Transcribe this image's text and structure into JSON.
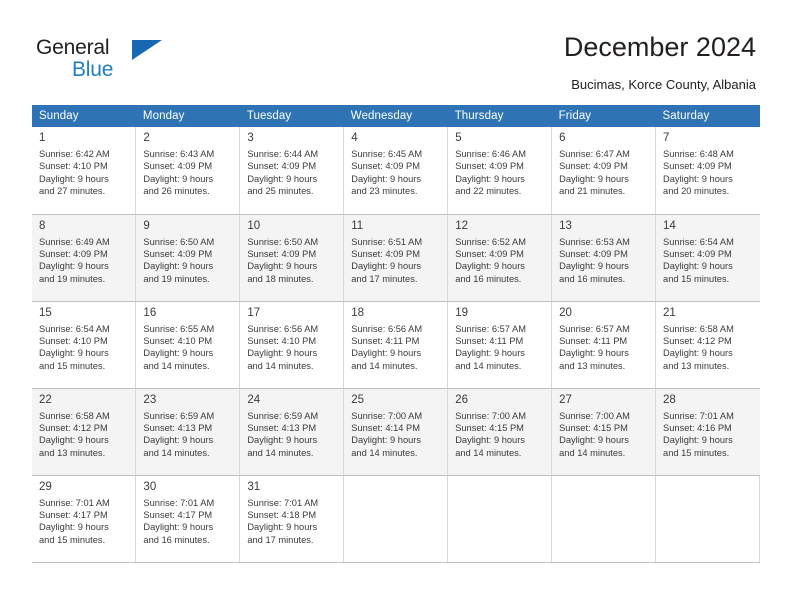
{
  "brand": {
    "word1": "General",
    "word2": "Blue",
    "triangle_color": "#1668b0",
    "blue_text_color": "#1f7ec4"
  },
  "header": {
    "title": "December 2024",
    "subtitle": "Bucimas, Korce County, Albania"
  },
  "theme": {
    "header_row_bg": "#2e74b5",
    "header_row_text": "#ffffff",
    "alt_row_bg": "#f4f4f4",
    "cell_text": "#3b3b3b",
    "grid_line": "#d9d9d9"
  },
  "weekday_headers": [
    "Sunday",
    "Monday",
    "Tuesday",
    "Wednesday",
    "Thursday",
    "Friday",
    "Saturday"
  ],
  "labels": {
    "sunrise_prefix": "Sunrise:",
    "sunset_prefix": "Sunset:",
    "daylight_prefix": "Daylight:"
  },
  "weeks": [
    [
      {
        "day": "1",
        "sunrise": "Sunrise: 6:42 AM",
        "sunset": "Sunset: 4:10 PM",
        "daylight_line1": "Daylight: 9 hours",
        "daylight_line2": "and 27 minutes."
      },
      {
        "day": "2",
        "sunrise": "Sunrise: 6:43 AM",
        "sunset": "Sunset: 4:09 PM",
        "daylight_line1": "Daylight: 9 hours",
        "daylight_line2": "and 26 minutes."
      },
      {
        "day": "3",
        "sunrise": "Sunrise: 6:44 AM",
        "sunset": "Sunset: 4:09 PM",
        "daylight_line1": "Daylight: 9 hours",
        "daylight_line2": "and 25 minutes."
      },
      {
        "day": "4",
        "sunrise": "Sunrise: 6:45 AM",
        "sunset": "Sunset: 4:09 PM",
        "daylight_line1": "Daylight: 9 hours",
        "daylight_line2": "and 23 minutes."
      },
      {
        "day": "5",
        "sunrise": "Sunrise: 6:46 AM",
        "sunset": "Sunset: 4:09 PM",
        "daylight_line1": "Daylight: 9 hours",
        "daylight_line2": "and 22 minutes."
      },
      {
        "day": "6",
        "sunrise": "Sunrise: 6:47 AM",
        "sunset": "Sunset: 4:09 PM",
        "daylight_line1": "Daylight: 9 hours",
        "daylight_line2": "and 21 minutes."
      },
      {
        "day": "7",
        "sunrise": "Sunrise: 6:48 AM",
        "sunset": "Sunset: 4:09 PM",
        "daylight_line1": "Daylight: 9 hours",
        "daylight_line2": "and 20 minutes."
      }
    ],
    [
      {
        "day": "8",
        "sunrise": "Sunrise: 6:49 AM",
        "sunset": "Sunset: 4:09 PM",
        "daylight_line1": "Daylight: 9 hours",
        "daylight_line2": "and 19 minutes."
      },
      {
        "day": "9",
        "sunrise": "Sunrise: 6:50 AM",
        "sunset": "Sunset: 4:09 PM",
        "daylight_line1": "Daylight: 9 hours",
        "daylight_line2": "and 19 minutes."
      },
      {
        "day": "10",
        "sunrise": "Sunrise: 6:50 AM",
        "sunset": "Sunset: 4:09 PM",
        "daylight_line1": "Daylight: 9 hours",
        "daylight_line2": "and 18 minutes."
      },
      {
        "day": "11",
        "sunrise": "Sunrise: 6:51 AM",
        "sunset": "Sunset: 4:09 PM",
        "daylight_line1": "Daylight: 9 hours",
        "daylight_line2": "and 17 minutes."
      },
      {
        "day": "12",
        "sunrise": "Sunrise: 6:52 AM",
        "sunset": "Sunset: 4:09 PM",
        "daylight_line1": "Daylight: 9 hours",
        "daylight_line2": "and 16 minutes."
      },
      {
        "day": "13",
        "sunrise": "Sunrise: 6:53 AM",
        "sunset": "Sunset: 4:09 PM",
        "daylight_line1": "Daylight: 9 hours",
        "daylight_line2": "and 16 minutes."
      },
      {
        "day": "14",
        "sunrise": "Sunrise: 6:54 AM",
        "sunset": "Sunset: 4:09 PM",
        "daylight_line1": "Daylight: 9 hours",
        "daylight_line2": "and 15 minutes."
      }
    ],
    [
      {
        "day": "15",
        "sunrise": "Sunrise: 6:54 AM",
        "sunset": "Sunset: 4:10 PM",
        "daylight_line1": "Daylight: 9 hours",
        "daylight_line2": "and 15 minutes."
      },
      {
        "day": "16",
        "sunrise": "Sunrise: 6:55 AM",
        "sunset": "Sunset: 4:10 PM",
        "daylight_line1": "Daylight: 9 hours",
        "daylight_line2": "and 14 minutes."
      },
      {
        "day": "17",
        "sunrise": "Sunrise: 6:56 AM",
        "sunset": "Sunset: 4:10 PM",
        "daylight_line1": "Daylight: 9 hours",
        "daylight_line2": "and 14 minutes."
      },
      {
        "day": "18",
        "sunrise": "Sunrise: 6:56 AM",
        "sunset": "Sunset: 4:11 PM",
        "daylight_line1": "Daylight: 9 hours",
        "daylight_line2": "and 14 minutes."
      },
      {
        "day": "19",
        "sunrise": "Sunrise: 6:57 AM",
        "sunset": "Sunset: 4:11 PM",
        "daylight_line1": "Daylight: 9 hours",
        "daylight_line2": "and 14 minutes."
      },
      {
        "day": "20",
        "sunrise": "Sunrise: 6:57 AM",
        "sunset": "Sunset: 4:11 PM",
        "daylight_line1": "Daylight: 9 hours",
        "daylight_line2": "and 13 minutes."
      },
      {
        "day": "21",
        "sunrise": "Sunrise: 6:58 AM",
        "sunset": "Sunset: 4:12 PM",
        "daylight_line1": "Daylight: 9 hours",
        "daylight_line2": "and 13 minutes."
      }
    ],
    [
      {
        "day": "22",
        "sunrise": "Sunrise: 6:58 AM",
        "sunset": "Sunset: 4:12 PM",
        "daylight_line1": "Daylight: 9 hours",
        "daylight_line2": "and 13 minutes."
      },
      {
        "day": "23",
        "sunrise": "Sunrise: 6:59 AM",
        "sunset": "Sunset: 4:13 PM",
        "daylight_line1": "Daylight: 9 hours",
        "daylight_line2": "and 14 minutes."
      },
      {
        "day": "24",
        "sunrise": "Sunrise: 6:59 AM",
        "sunset": "Sunset: 4:13 PM",
        "daylight_line1": "Daylight: 9 hours",
        "daylight_line2": "and 14 minutes."
      },
      {
        "day": "25",
        "sunrise": "Sunrise: 7:00 AM",
        "sunset": "Sunset: 4:14 PM",
        "daylight_line1": "Daylight: 9 hours",
        "daylight_line2": "and 14 minutes."
      },
      {
        "day": "26",
        "sunrise": "Sunrise: 7:00 AM",
        "sunset": "Sunset: 4:15 PM",
        "daylight_line1": "Daylight: 9 hours",
        "daylight_line2": "and 14 minutes."
      },
      {
        "day": "27",
        "sunrise": "Sunrise: 7:00 AM",
        "sunset": "Sunset: 4:15 PM",
        "daylight_line1": "Daylight: 9 hours",
        "daylight_line2": "and 14 minutes."
      },
      {
        "day": "28",
        "sunrise": "Sunrise: 7:01 AM",
        "sunset": "Sunset: 4:16 PM",
        "daylight_line1": "Daylight: 9 hours",
        "daylight_line2": "and 15 minutes."
      }
    ],
    [
      {
        "day": "29",
        "sunrise": "Sunrise: 7:01 AM",
        "sunset": "Sunset: 4:17 PM",
        "daylight_line1": "Daylight: 9 hours",
        "daylight_line2": "and 15 minutes."
      },
      {
        "day": "30",
        "sunrise": "Sunrise: 7:01 AM",
        "sunset": "Sunset: 4:17 PM",
        "daylight_line1": "Daylight: 9 hours",
        "daylight_line2": "and 16 minutes."
      },
      {
        "day": "31",
        "sunrise": "Sunrise: 7:01 AM",
        "sunset": "Sunset: 4:18 PM",
        "daylight_line1": "Daylight: 9 hours",
        "daylight_line2": "and 17 minutes."
      },
      {
        "day": "",
        "sunrise": "",
        "sunset": "",
        "daylight_line1": "",
        "daylight_line2": ""
      },
      {
        "day": "",
        "sunrise": "",
        "sunset": "",
        "daylight_line1": "",
        "daylight_line2": ""
      },
      {
        "day": "",
        "sunrise": "",
        "sunset": "",
        "daylight_line1": "",
        "daylight_line2": ""
      },
      {
        "day": "",
        "sunrise": "",
        "sunset": "",
        "daylight_line1": "",
        "daylight_line2": ""
      }
    ]
  ]
}
